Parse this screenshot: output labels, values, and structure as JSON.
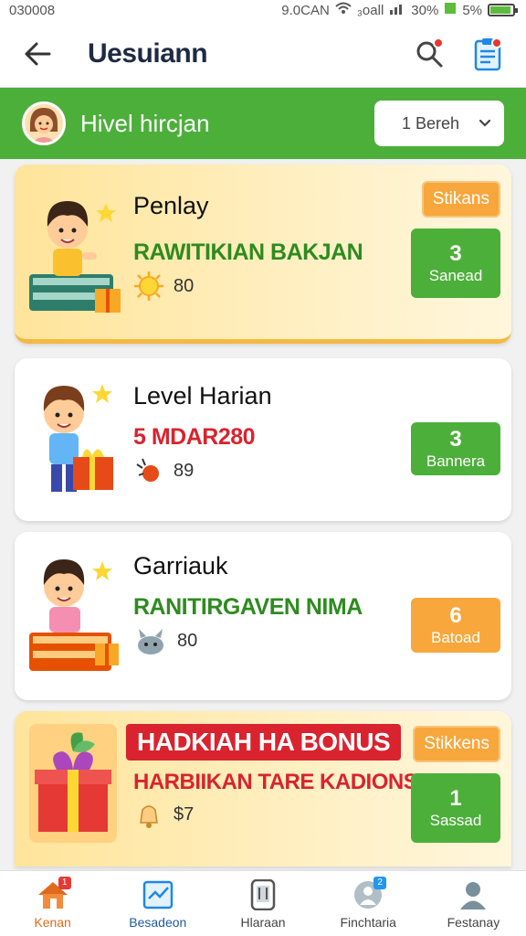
{
  "status_bar": {
    "left": "030008",
    "center": "9.0CAN",
    "signal": "₃oall",
    "battery_pct": "30%",
    "extra": "5%"
  },
  "header": {
    "title": "Uesuiann"
  },
  "level_bar": {
    "name": "Hivel hircjan",
    "select_value": "1 Bereh"
  },
  "cards": [
    {
      "title": "Penlay",
      "subtitle": "RAWITIKIAN BAKJAN",
      "reward": "80",
      "tag": "Stikans",
      "btn_num": "3",
      "btn_label": "Sanead"
    },
    {
      "title": "Level Harian",
      "subtitle": "5 MDAR280",
      "reward": "89",
      "btn_num": "3",
      "btn_label": "Bannera"
    },
    {
      "title": "Garriauk",
      "subtitle": "RANITIRGAVEN NIMA",
      "reward": "80",
      "btn_num": "6",
      "btn_label": "Batoad"
    },
    {
      "badge": "HADKIAH HA BONUS",
      "subtitle": "HARBIIKAN TARE KADIONS.",
      "reward": "$7",
      "tag": "Stikkens",
      "btn_num": "1",
      "btn_label": "Sassad"
    }
  ],
  "bottom_nav": [
    {
      "label": "Kenan",
      "icon": "home-icon",
      "badge": "1"
    },
    {
      "label": "Besadeon",
      "icon": "chart-icon"
    },
    {
      "label": "Hlaraan",
      "icon": "phone-icon"
    },
    {
      "label": "Finchtaria",
      "icon": "group-icon",
      "badge": "2"
    },
    {
      "label": "Festanay",
      "icon": "profile-icon"
    }
  ],
  "colors": {
    "green": "#4caf3a",
    "orange": "#f8a73c",
    "red": "#d9232e",
    "title": "#1f2a44"
  }
}
